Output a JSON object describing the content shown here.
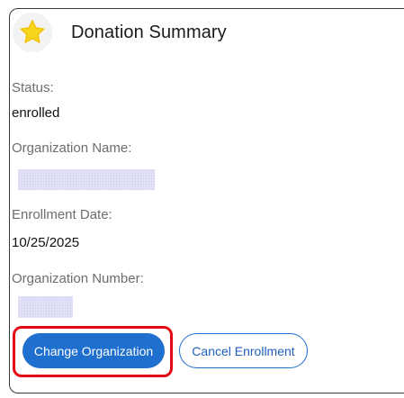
{
  "card": {
    "title": "Donation Summary",
    "icon": "star-icon"
  },
  "fields": {
    "status_label": "Status:",
    "status_value": "enrolled",
    "org_name_label": "Organization Name:",
    "enrollment_date_label": "Enrollment Date:",
    "enrollment_date_value": "10/25/2025",
    "org_number_label": "Organization Number:"
  },
  "actions": {
    "change_org_label": "Change Organization",
    "cancel_enrollment_label": "Cancel Enrollment"
  },
  "colors": {
    "primary": "#1f6fcf",
    "highlight": "#e30613",
    "star": "#f7d51d"
  }
}
